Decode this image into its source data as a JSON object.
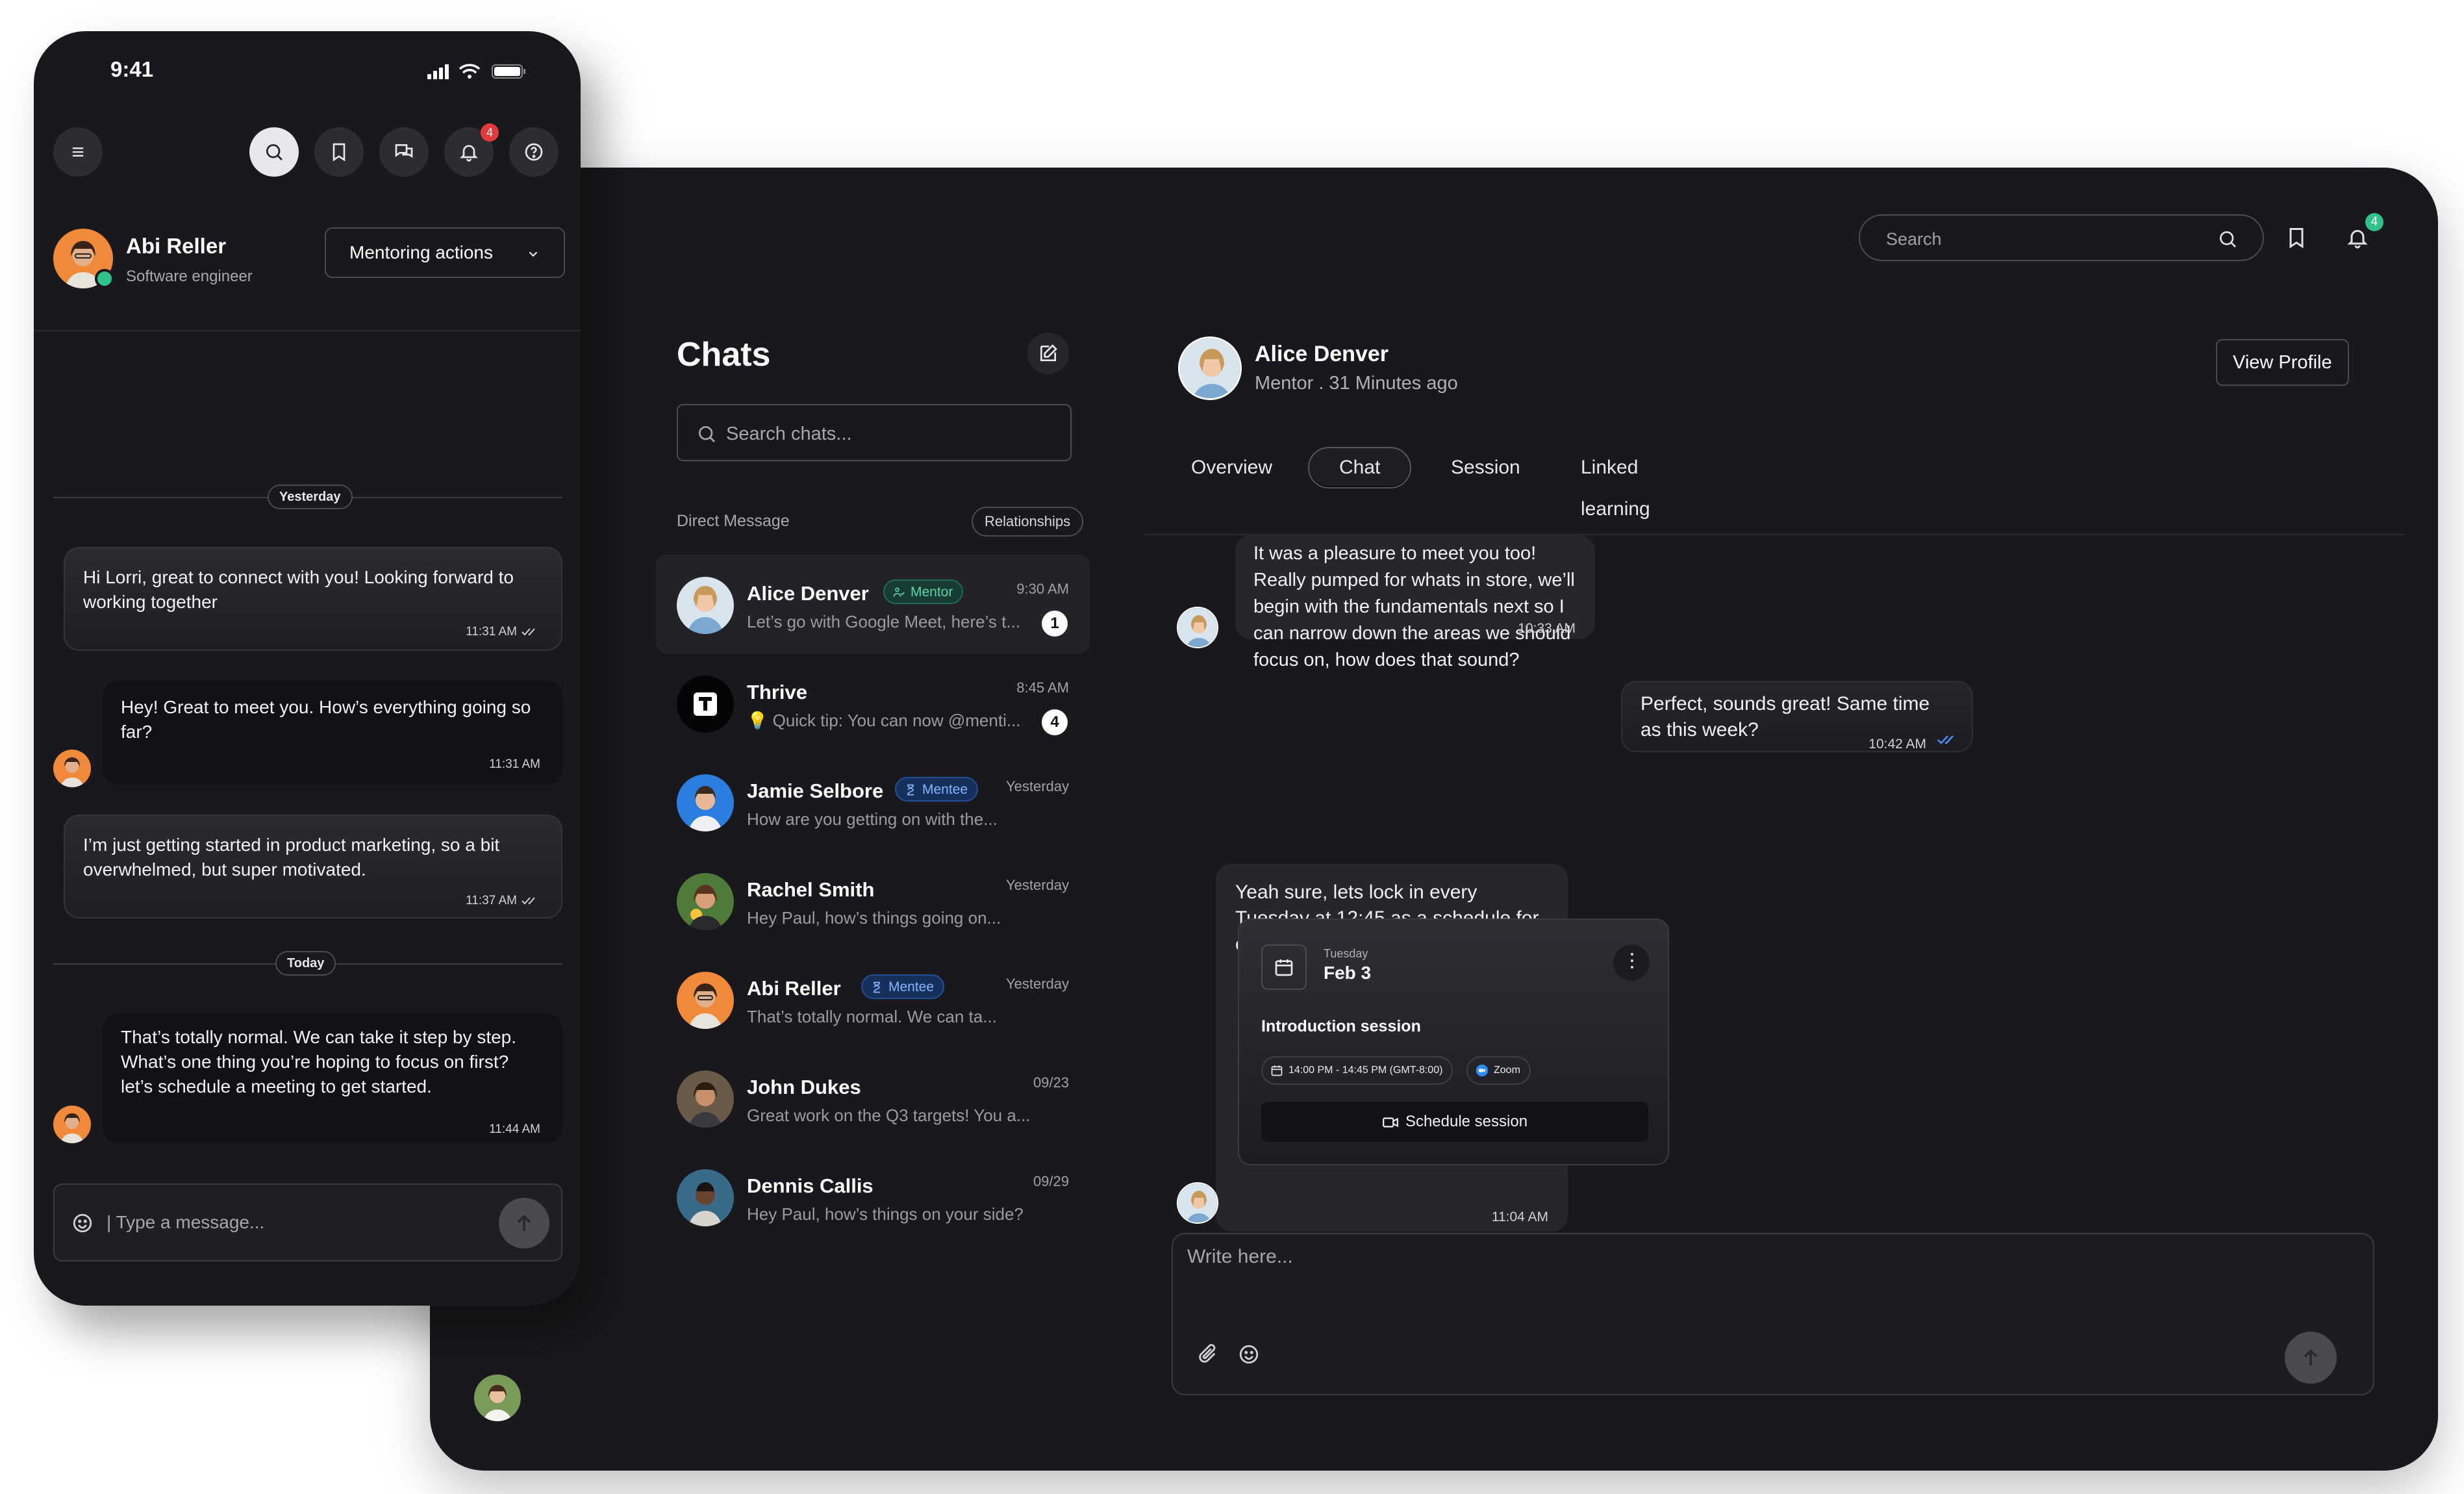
{
  "desktop": {
    "search": {
      "placeholder": "Search"
    },
    "notification_count": "4",
    "chats": {
      "title": "Chats",
      "search_placeholder": "Search chats...",
      "section_label": "Direct Message",
      "relationships_label": "Relationships",
      "items": [
        {
          "name": "Alice Denver",
          "role": "Mentor",
          "preview": "Let’s go with Google Meet, here’s t...",
          "time": "9:30 AM",
          "unread": "1"
        },
        {
          "name": "Thrive",
          "role": "",
          "preview": "💡 Quick tip: You can now @menti...",
          "time": "8:45 AM",
          "unread": "4"
        },
        {
          "name": "Jamie Selbore",
          "role": "Mentee",
          "preview": "How are you getting on with the...",
          "time": "Yesterday",
          "unread": ""
        },
        {
          "name": "Rachel Smith",
          "role": "",
          "preview": "Hey Paul, how’s things going on...",
          "time": "Yesterday",
          "unread": ""
        },
        {
          "name": "Abi Reller",
          "role": "Mentee",
          "preview": "That’s totally normal. We can ta...",
          "time": "Yesterday",
          "unread": ""
        },
        {
          "name": "John Dukes",
          "role": "",
          "preview": "Great work on the Q3 targets! You a...",
          "time": "09/23",
          "unread": ""
        },
        {
          "name": "Dennis Callis",
          "role": "",
          "preview": "Hey Paul, how’s things on your side?",
          "time": "09/29",
          "unread": ""
        }
      ]
    },
    "conversation": {
      "name": "Alice Denver",
      "status": "Mentor . 31 Minutes ago",
      "view_profile_label": "View Profile",
      "tabs": [
        "Overview",
        "Chat",
        "Session",
        "Linked learning"
      ],
      "active_tab": "Chat",
      "messages": [
        {
          "text": "It was a pleasure to meet you too! Really pumped for whats in store, we’ll begin with the fundamentals next so I can narrow down the areas we should focus on, how does that sound?",
          "time": "10:33 AM"
        },
        {
          "text": "Perfect, sounds great! Same time as this week?",
          "time": "10:42 AM"
        },
        {
          "text": "Yeah sure, lets lock in every Tuesday at 12:45 as a schedule for our sessions.",
          "time": "11:04 AM"
        }
      ],
      "session_card": {
        "day": "Tuesday",
        "date": "Feb 3",
        "title": "Introduction session",
        "time_chip": "14:00 PM - 14:45 PM (GMT-8:00)",
        "platform_chip": "Zoom",
        "button_label": "Schedule session"
      },
      "composer_placeholder": "Write here..."
    }
  },
  "mobile": {
    "time": "9:41",
    "notification_count": "4",
    "profile": {
      "name": "Abi Reller",
      "role": "Software engineer"
    },
    "mentoring_actions_label": "Mentoring actions",
    "separators": {
      "yesterday": "Yesterday",
      "today": "Today"
    },
    "messages": [
      {
        "text": "Hi Lorri, great to connect with you! Looking forward to working together",
        "time": "11:31 AM"
      },
      {
        "text": "Hey! Great to meet you. How’s everything going so far?",
        "time": "11:31 AM"
      },
      {
        "text": "I’m just getting started in product marketing, so a bit overwhelmed, but super motivated.",
        "time": "11:37 AM"
      },
      {
        "text": "That’s totally normal. We can take it step by step. What’s one thing you’re hoping to focus on first? let’s schedule a meeting to get started.",
        "time": "11:44 AM"
      }
    ],
    "composer_placeholder": "| Type a message..."
  },
  "colors": {
    "background": "#19191d",
    "bubble": "#26262c",
    "mentor_badge": "#5fd3a8",
    "mentee_badge": "#86b4ff",
    "notification_red": "#e53a3a",
    "notification_green": "#2ec38b",
    "read_check": "#4d8ef7"
  },
  "icons": [
    "search-icon",
    "bookmark-icon",
    "bell-icon",
    "compose-icon",
    "calendar-icon",
    "video-icon",
    "attach-icon",
    "emoji-icon",
    "send-icon",
    "menu-icon",
    "chat-icon",
    "help-icon",
    "chevron-down-icon",
    "check-icon"
  ]
}
